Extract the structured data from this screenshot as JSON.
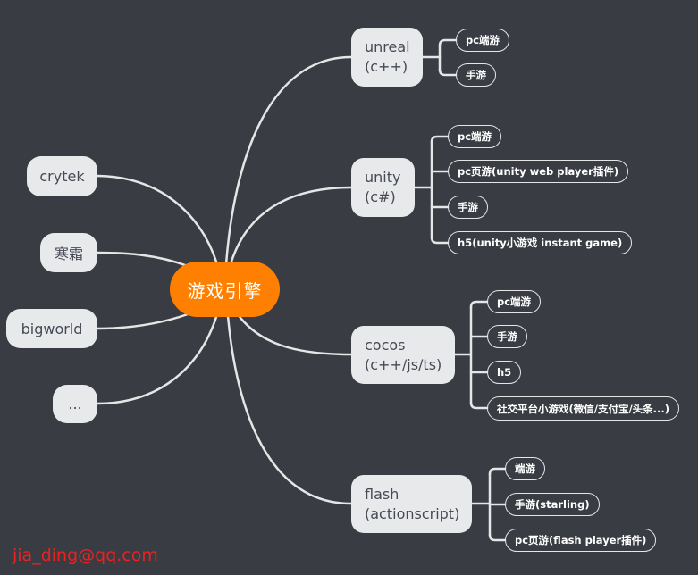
{
  "central": {
    "label": "游戏引擎"
  },
  "colors": {
    "background": "#393c42",
    "central_fill": "#ff8000",
    "node_fill": "#e8e9eb",
    "node_text": "#454a55",
    "connector": "#e6e6e6",
    "watermark": "#ee2020"
  },
  "left_branches": [
    {
      "label": "crytek"
    },
    {
      "label": "寒霜"
    },
    {
      "label": "bigworld"
    },
    {
      "label": "..."
    }
  ],
  "right_branches": [
    {
      "line1": "unreal",
      "line2": "(c++)",
      "children": [
        "pc端游",
        "手游"
      ]
    },
    {
      "line1": "unity",
      "line2": "(c#)",
      "children": [
        "pc端游",
        "pc页游(unity web player插件)",
        "手游",
        "h5(unity小游戏 instant game)"
      ]
    },
    {
      "line1": "cocos",
      "line2": "(c++/js/ts)",
      "children": [
        "pc端游",
        "手游",
        "h5",
        "社交平台小游戏(微信/支付宝/头条...)"
      ]
    },
    {
      "line1": "flash",
      "line2": "(actionscript)",
      "children": [
        "端游",
        "手游(starling)",
        "pc页游(flash player插件)"
      ]
    }
  ],
  "watermark": "jia_ding@qq.com"
}
